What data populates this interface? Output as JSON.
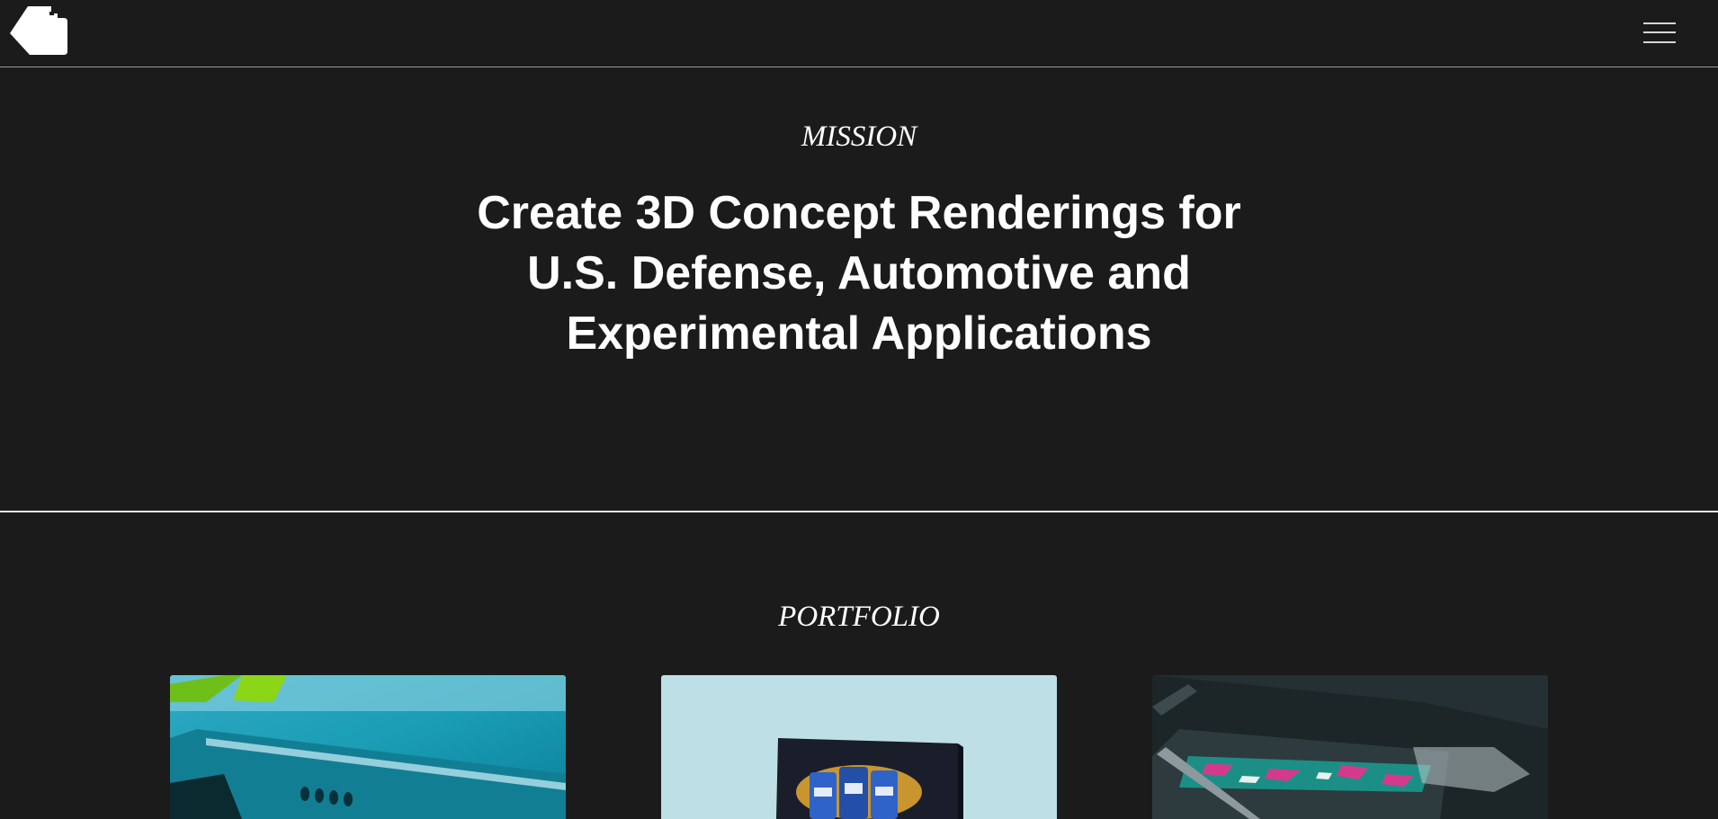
{
  "header": {
    "logo_icon": "logo-shape-icon",
    "menu_icon": "hamburger-menu-icon"
  },
  "mission": {
    "label": "MISSION",
    "headline_lines": [
      "Create 3D Concept Renderings for",
      "U.S. Defense, Automotive and",
      "Experimental Applications"
    ]
  },
  "portfolio": {
    "label": "PORTFOLIO",
    "items": [
      {
        "image": "teal-aircraft-render"
      },
      {
        "image": "beer-can-poster-render"
      },
      {
        "image": "camo-vehicle-render"
      }
    ]
  },
  "colors": {
    "background": "#1b1b1b",
    "text": "#ffffff",
    "divider": "#e8e8e8"
  }
}
